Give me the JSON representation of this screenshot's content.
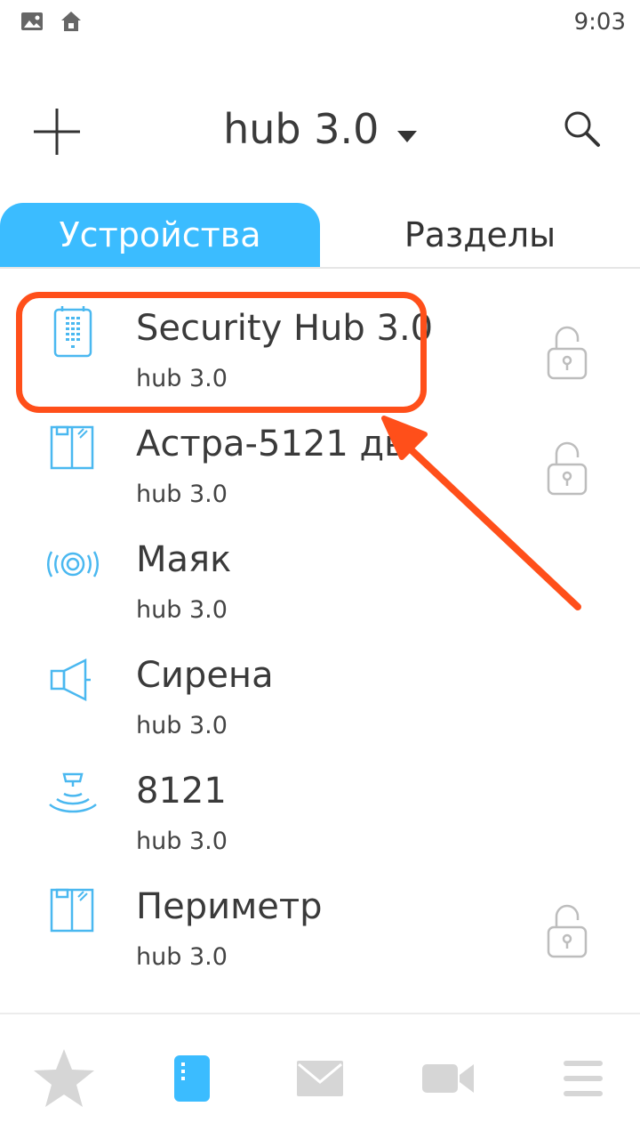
{
  "status_bar": {
    "time": "9:03",
    "icons": [
      "image-icon",
      "home-icon"
    ]
  },
  "header": {
    "title": "hub 3.0",
    "add_icon": "plus-icon",
    "dropdown_icon": "caret-down-icon",
    "search_icon": "search-icon"
  },
  "tabs": [
    {
      "label": "Устройства",
      "active": true
    },
    {
      "label": "Разделы",
      "active": false
    }
  ],
  "devices": [
    {
      "name": "Security Hub 3.0",
      "hub": "hub 3.0",
      "icon": "hub-panel-icon",
      "lock": true,
      "highlighted": true
    },
    {
      "name": "Астра-5121 дв",
      "hub": "hub 3.0",
      "icon": "door-sensor-icon",
      "lock": true
    },
    {
      "name": "Маяк",
      "hub": "hub 3.0",
      "icon": "beacon-icon",
      "lock": false
    },
    {
      "name": "Сирена",
      "hub": "hub 3.0",
      "icon": "siren-icon",
      "lock": false
    },
    {
      "name": "8121",
      "hub": "hub 3.0",
      "icon": "motion-sensor-icon",
      "lock": false
    },
    {
      "name": "Периметр",
      "hub": "hub 3.0",
      "icon": "door-sensor-icon",
      "lock": true
    }
  ],
  "bottom_nav": [
    {
      "icon": "star-icon",
      "active": false
    },
    {
      "icon": "device-icon",
      "active": true
    },
    {
      "icon": "mail-icon",
      "active": false
    },
    {
      "icon": "video-camera-icon",
      "active": false
    },
    {
      "icon": "menu-icon",
      "active": false
    }
  ],
  "colors": {
    "accent": "#3bbcff",
    "annotation": "#ff4f1a",
    "icon_blue": "#4ab8f0",
    "lock_gray": "#bdbdbd",
    "nav_gray": "#d6d6d6"
  }
}
